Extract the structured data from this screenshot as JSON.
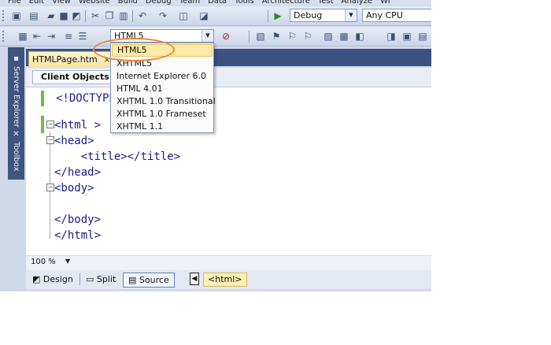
{
  "menu": [
    "File",
    "Edit",
    "View",
    "Website",
    "Build",
    "Debug",
    "Team",
    "Data",
    "Tools",
    "Architecture",
    "Test",
    "Analyze",
    "Wi"
  ],
  "toolbar1": {
    "config_value": "Debug",
    "platform_value": "Any CPU"
  },
  "toolbar2": {
    "schema_value": "HTML5"
  },
  "schema_dropdown": {
    "items": [
      "HTML5",
      "XHTML5",
      "Internet Explorer 6.0",
      "HTML 4.01",
      "XHTML 1.0 Transitional",
      "XHTML 1.0 Frameset",
      "XHTML 1.1"
    ],
    "selected": "HTML5"
  },
  "side_tabs": {
    "server_explorer": "Server Explorer",
    "toolbox": "Toolbox"
  },
  "document": {
    "tab_label": "HTMLPage.htm",
    "close_glyph": "×",
    "nav_object": "Client Objects & Events"
  },
  "code": [
    "<!DOCTYPE html>",
    "<html >",
    "<head>",
    "    <title></title>",
    "</head>",
    "<body>",
    "",
    "</body>",
    "</html>"
  ],
  "footer": {
    "zoom": "100 %",
    "views": {
      "design": "Design",
      "split": "Split",
      "source": "Source"
    },
    "crumb": "<html>"
  },
  "colors": {
    "accent_highlight": "#e8883a",
    "selected_item": "#fde9a8",
    "panel_blue": "#3b5184"
  }
}
